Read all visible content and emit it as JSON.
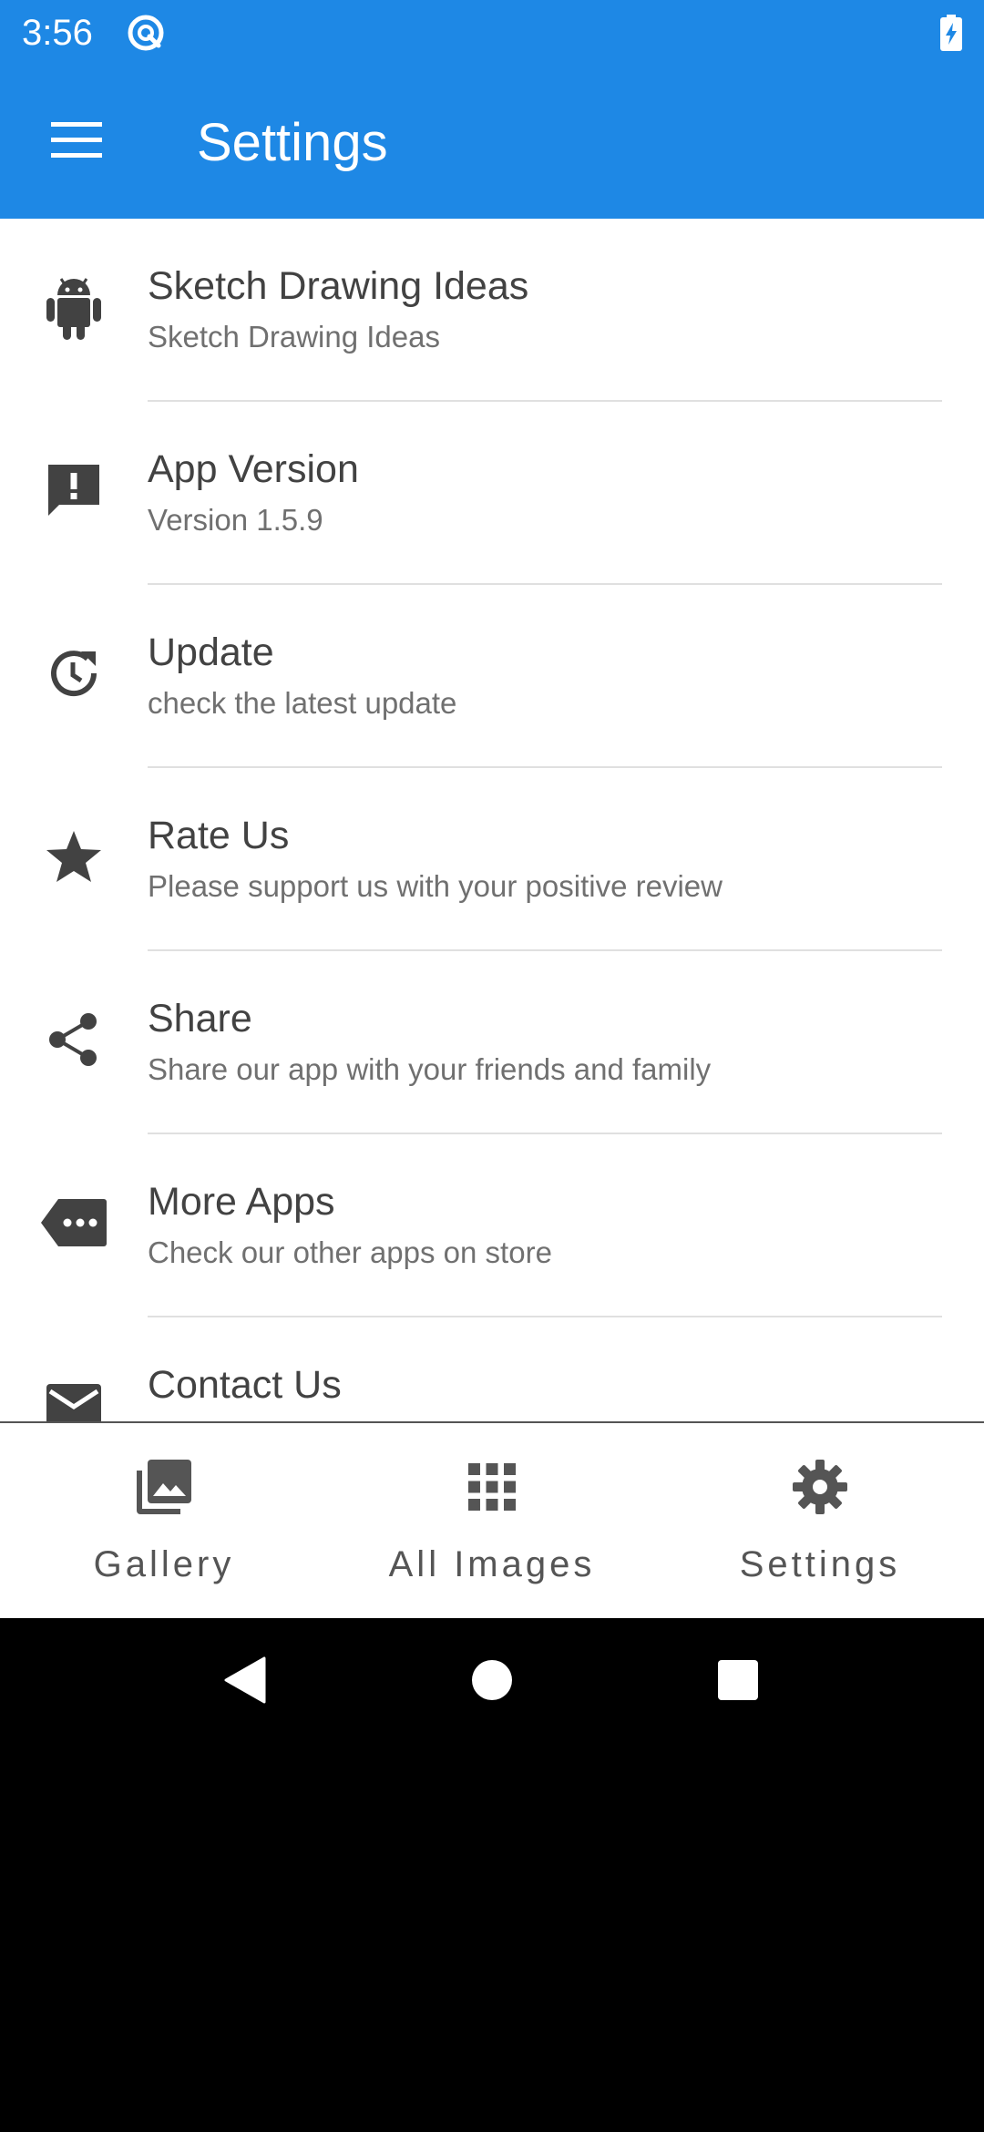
{
  "status_bar": {
    "time": "3:56"
  },
  "app_bar": {
    "title": "Settings"
  },
  "settings": [
    {
      "icon": "android-icon",
      "title": "Sketch Drawing Ideas",
      "subtitle": "Sketch Drawing Ideas"
    },
    {
      "icon": "feedback-icon",
      "title": "App Version",
      "subtitle": "Version 1.5.9"
    },
    {
      "icon": "update-icon",
      "title": "Update",
      "subtitle": "check the latest update"
    },
    {
      "icon": "star-icon",
      "title": "Rate Us",
      "subtitle": "Please support us with your positive review"
    },
    {
      "icon": "share-icon",
      "title": "Share",
      "subtitle": "Share our app with your friends and family"
    },
    {
      "icon": "more-apps-icon",
      "title": "More Apps",
      "subtitle": "Check our other apps on store"
    },
    {
      "icon": "mail-icon",
      "title": "Contact Us",
      "subtitle": ""
    }
  ],
  "bottom_nav": [
    {
      "icon": "gallery-icon",
      "label": "Gallery"
    },
    {
      "icon": "grid-icon",
      "label": "All Images"
    },
    {
      "icon": "gear-icon",
      "label": "Settings"
    }
  ],
  "colors": {
    "primary": "#1e88e5",
    "icon": "#424242",
    "text_primary": "#424242",
    "text_secondary": "#707070"
  }
}
